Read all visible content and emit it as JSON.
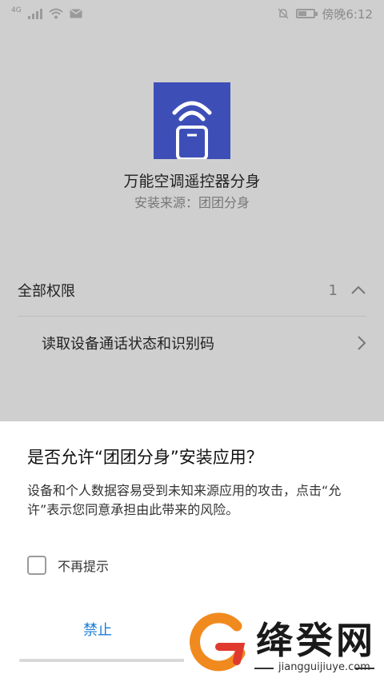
{
  "status_bar": {
    "network": "4G",
    "time": "傍晚6:12"
  },
  "app": {
    "name": "万能空调遥控器分身",
    "source": "安装来源：团团分身"
  },
  "permissions": {
    "header_label": "全部权限",
    "count": "1",
    "items": [
      {
        "label": "读取设备通话状态和识别码"
      }
    ]
  },
  "dialog": {
    "title": "是否允许“团团分身”安装应用？",
    "message": "设备和个人数据容易受到未知来源应用的攻击，点击“允许”表示您同意承担由此带来的风险。",
    "checkbox_label": "不再提示",
    "checkbox_checked": false,
    "deny_label": "禁止"
  },
  "watermark": {
    "text": "绛癸网",
    "sub": "jiangguijiuye.com"
  },
  "colors": {
    "background": "#cfcfcf",
    "app_icon": "#3d4fb7",
    "deny_text": "#1c7dd6",
    "watermark_orange": "#f08a1e",
    "watermark_red": "#e03a2e"
  }
}
